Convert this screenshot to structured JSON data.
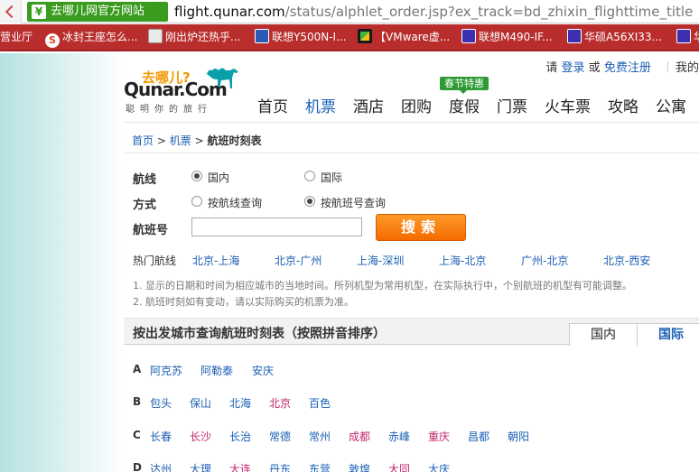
{
  "browser": {
    "tab_title": "去哪儿网官方网站",
    "url_domain": "flight.qunar.com",
    "url_path": "/status/alphlet_order.jsp?ex_track=bd_zhixin_flighttime_title"
  },
  "bookmarks": [
    {
      "label": "营业厅",
      "icon": "none"
    },
    {
      "label": "冰封王座怎么...",
      "icon": "s-logo-icon"
    },
    {
      "label": "刚出炉还热乎...",
      "icon": "generic-page-icon"
    },
    {
      "label": "联想Y500N-I...",
      "icon": "lenovo-icon"
    },
    {
      "label": "【VMware虚...",
      "icon": "vmware-icon"
    },
    {
      "label": "联想M490-IF...",
      "icon": "lenovo-icon"
    },
    {
      "label": "华硕A56XI33...",
      "icon": "lenovo-icon"
    },
    {
      "label": "华",
      "icon": "lenovo-icon"
    }
  ],
  "logo": {
    "tagline_cn": "去哪儿?",
    "brand": "Qunar.Com",
    "slogan": "聪明你的旅行"
  },
  "toplinks": {
    "please": "请",
    "login": "登录",
    "or": "或",
    "register": "免费注册",
    "my": "我的"
  },
  "nav": {
    "festival_badge": "春节特惠",
    "items": [
      "首页",
      "机票",
      "酒店",
      "团购",
      "度假",
      "门票",
      "火车票",
      "攻略",
      "公寓"
    ],
    "active": "机票"
  },
  "breadcrumb": {
    "home": "首页",
    "flights": "机票",
    "sep": ">",
    "current": "航班时刻表"
  },
  "form": {
    "route_label": "航线",
    "route_options": [
      "国内",
      "国际"
    ],
    "route_selected": "国内",
    "mode_label": "方式",
    "mode_options": [
      "按航线查询",
      "按航班号查询"
    ],
    "mode_selected": "按航班号查询",
    "flightno_label": "航班号",
    "flightno_value": "",
    "search_label": "搜索"
  },
  "hot_routes": {
    "label": "热门航线",
    "routes": [
      "北京-上海",
      "北京-广州",
      "上海-深圳",
      "上海-北京",
      "广州-北京",
      "北京-西安"
    ]
  },
  "notes": [
    "1. 显示的日期和时间为相应城市的当地时间。所列机型为常用机型，在实际执行中，个别航班的机型有可能调整。",
    "2. 航班时刻如有变动，请以实际购买的机票为准。"
  ],
  "city_section": {
    "title": "按出发城市查询航班时刻表（按照拼音排序）",
    "tabs": [
      "国内",
      "国际"
    ],
    "active_tab": "国内",
    "groups": [
      {
        "letter": "A",
        "cities": [
          "阿克苏",
          "阿勒泰",
          "安庆"
        ]
      },
      {
        "letter": "B",
        "cities": [
          "包头",
          "保山",
          "北海",
          "北京",
          "百色"
        ]
      },
      {
        "letter": "C",
        "cities": [
          "长春",
          "长沙",
          "长治",
          "常德",
          "常州",
          "成都",
          "赤峰",
          "重庆",
          "昌都",
          "朝阳"
        ]
      },
      {
        "letter": "D",
        "cities": [
          "达州",
          "大理",
          "大连",
          "丹东",
          "东营",
          "敦煌",
          "大同",
          "大庆"
        ]
      }
    ],
    "highlight_color": "#c0266e",
    "link_color": "#1a5fb4"
  }
}
